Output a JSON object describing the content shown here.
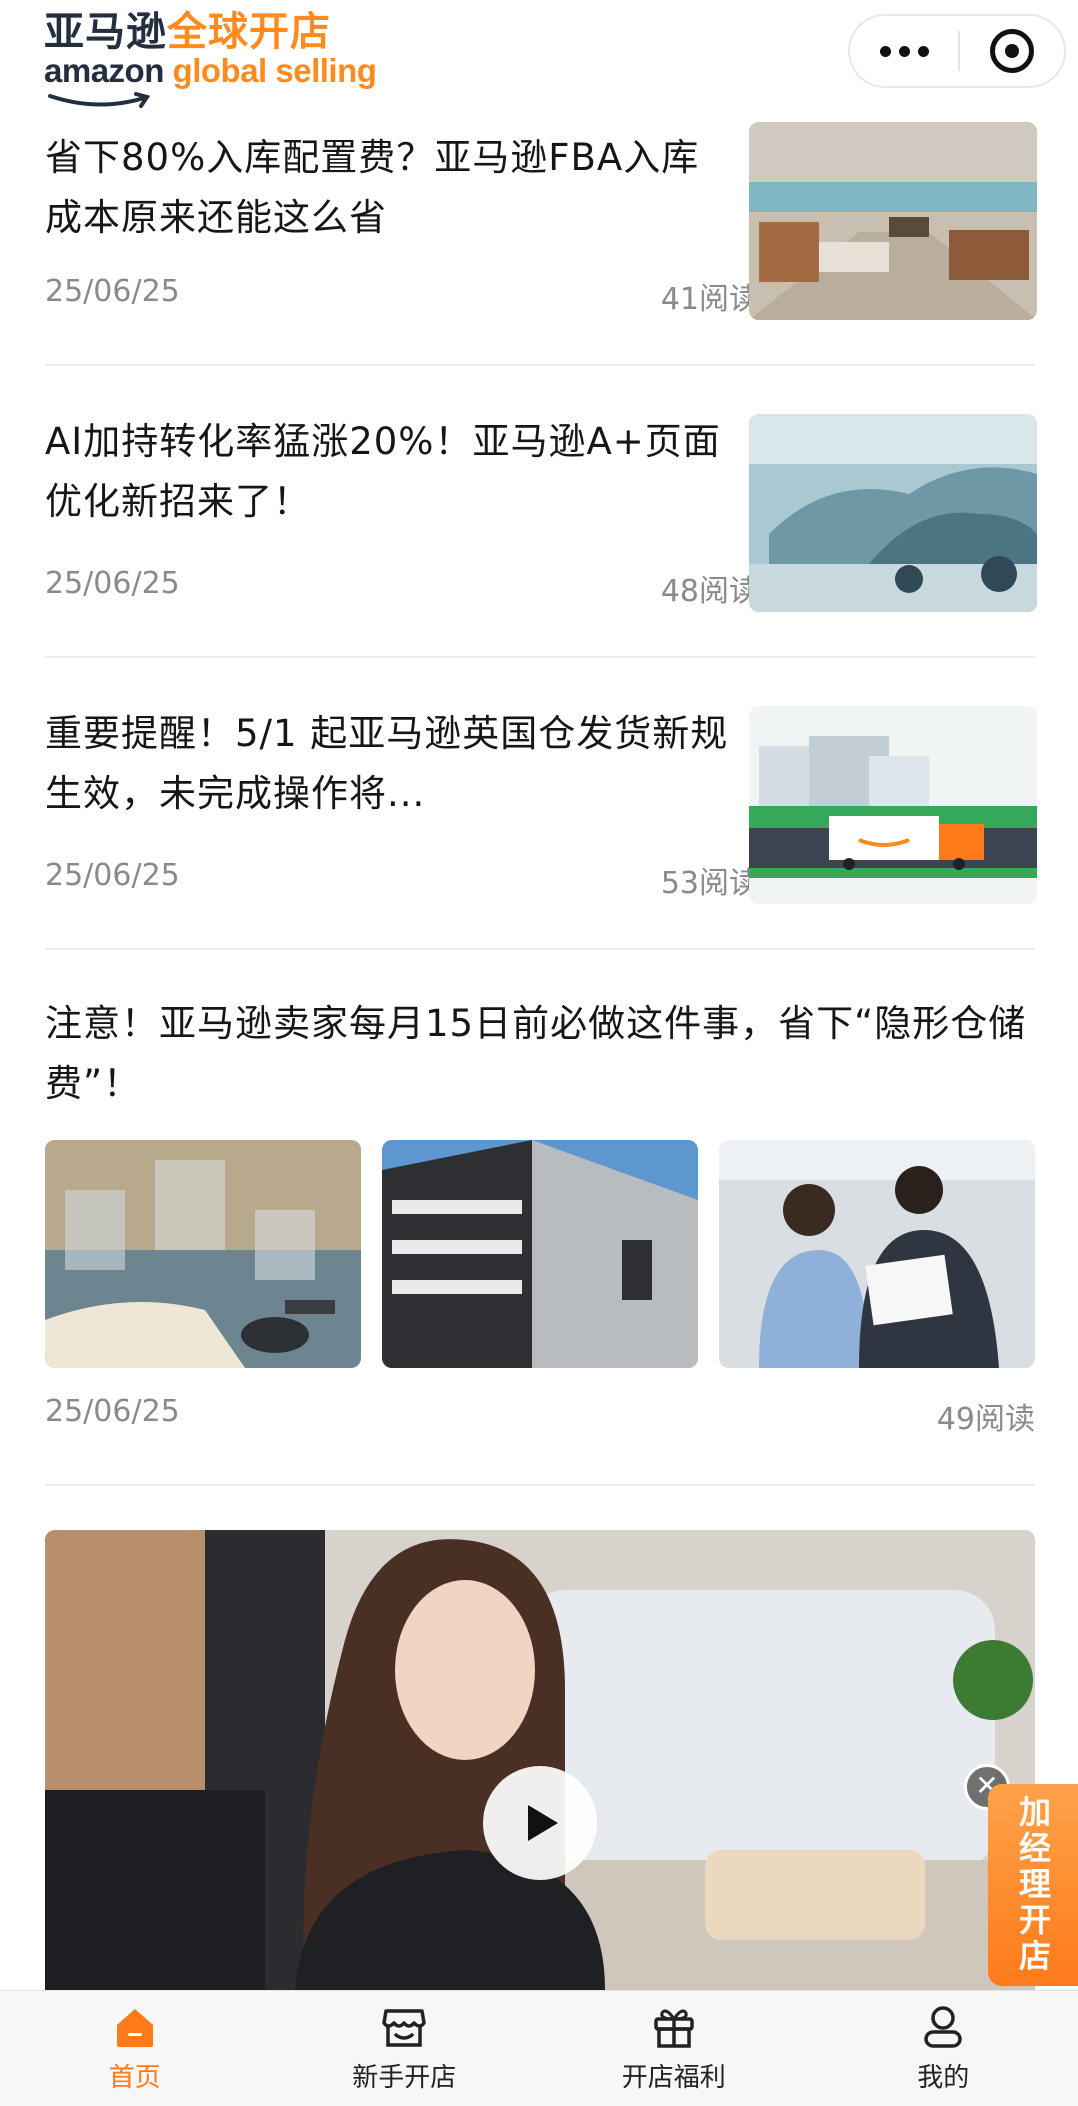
{
  "header": {
    "brand_cn_dark": "亚马逊",
    "brand_cn_orange": "全球开店",
    "brand_en_dark": "amazon",
    "brand_en_orange": "global selling"
  },
  "articles": [
    {
      "title": "省下80%入库配置费？亚马逊FBA入库成本原来还能这么省",
      "date": "25/06/25",
      "reads": "41阅读",
      "thumb": "store-interior"
    },
    {
      "title": "AI加持转化率猛涨20%！亚马逊A+页面优化新招来了！",
      "date": "25/06/25",
      "reads": "48阅读",
      "thumb": "car-factory"
    },
    {
      "title": "重要提醒！5/1 起亚马逊英国仓发货新规生效，未完成操作将...",
      "date": "25/06/25",
      "reads": "53阅读",
      "thumb": "amazon-truck"
    },
    {
      "title": "注意！亚马逊卖家每月15日前必做这件事，省下“隐形仓储费”！",
      "date": "25/06/25",
      "reads": "49阅读",
      "thumbs": [
        "book-gavel",
        "warehouse-building",
        "business-people"
      ]
    }
  ],
  "video": {
    "thumb": "woman-office"
  },
  "floating": {
    "label": "加经理开店",
    "close": "✕"
  },
  "tabbar": {
    "items": [
      {
        "label": "首页",
        "icon": "home-icon",
        "active": true
      },
      {
        "label": "新手开店",
        "icon": "store-icon",
        "active": false
      },
      {
        "label": "开店福利",
        "icon": "gift-icon",
        "active": false
      },
      {
        "label": "我的",
        "icon": "user-icon",
        "active": false
      }
    ]
  },
  "colors": {
    "accent": "#ff7a1a",
    "text": "#161616",
    "meta": "#8a8a8a"
  }
}
